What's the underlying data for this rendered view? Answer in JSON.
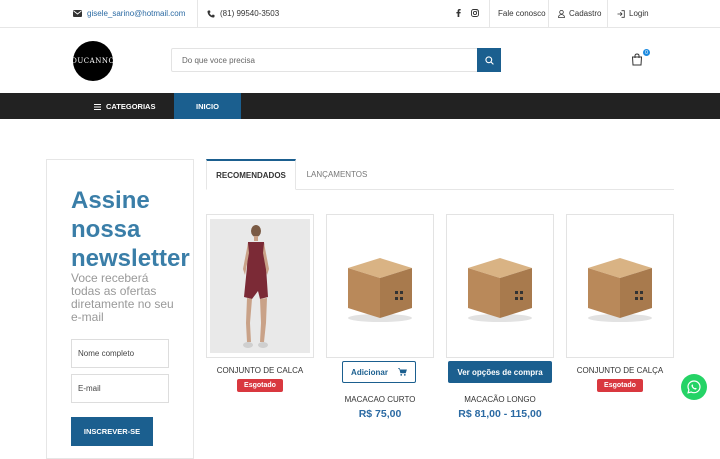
{
  "topbar": {
    "email": "gisele_sarino@hotmail.com",
    "phone": "(81) 99540-3503",
    "contact_label": "Fale conosco",
    "register_label": "Cadastro",
    "login_label": "Login"
  },
  "header": {
    "logo_text": "DUCANNO",
    "search_placeholder": "Do que voce precisa",
    "cart_count": "0"
  },
  "nav": {
    "categories_label": "CATEGORIAS",
    "home_label": "INICIO"
  },
  "newsletter": {
    "title": "Assine nossa newsletter",
    "subtitle": "Voce receberá todas as ofertas diretamente no seu e-mail",
    "name_placeholder": "Nome completo",
    "email_placeholder": "E-mail",
    "subscribe_label": "INSCREVER-SE"
  },
  "tabs": [
    {
      "label": "RECOMENDADOS",
      "active": true
    },
    {
      "label": "LANÇAMENTOS",
      "active": false
    }
  ],
  "products": [
    {
      "name": "CONJUNTO DE CALCA",
      "status": "Esgotado",
      "image": "model-photo"
    },
    {
      "name": "MACACAO CURTO",
      "button": "Adicionar",
      "price": "R$ 75,00",
      "image": "box-placeholder"
    },
    {
      "name": "MACACÃO LONGO",
      "button": "Ver opções de compra",
      "price": "R$ 81,00 - 115,00",
      "image": "box-placeholder"
    },
    {
      "name": "CONJUNTO DE CALÇA",
      "status": "Esgotado",
      "image": "box-placeholder"
    }
  ],
  "colors": {
    "primary": "#1b5f8f",
    "navbar": "#222222",
    "soldout": "#d9383f",
    "heading": "#3a7ea8",
    "whatsapp": "#25d366"
  }
}
